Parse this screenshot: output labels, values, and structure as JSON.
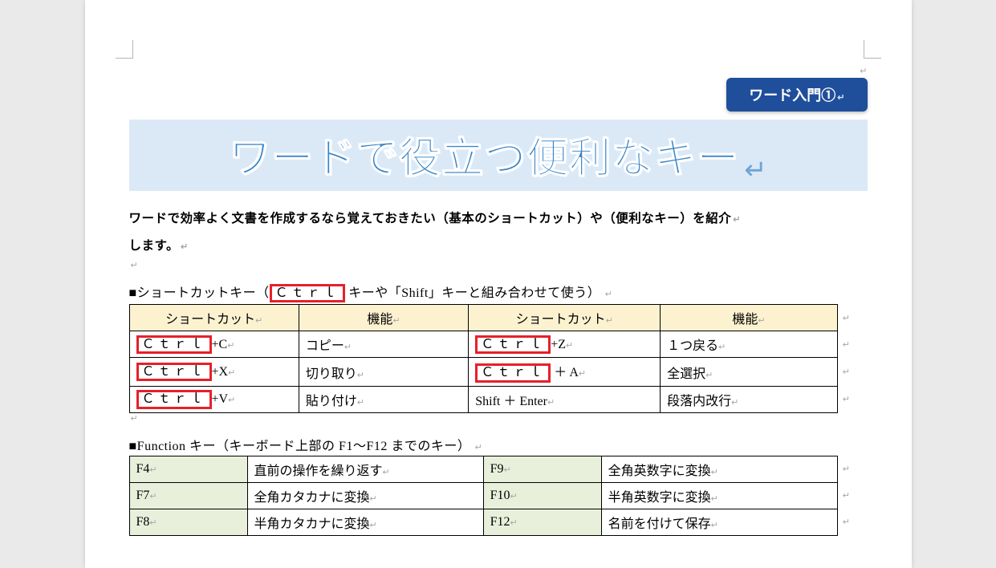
{
  "badge": "ワード入門①",
  "title": "ワードで役立つ便利なキー",
  "intro_line1": "ワードで効率よく文書を作成するなら覚えておきたい（基本のショートカット）や（便利なキー）を紹介",
  "intro_line2": "します。",
  "section1": {
    "prefix": "■ショートカットキー（",
    "highlight": "Ｃｔｒｌ",
    "suffix": " キーや「Shift」キーと組み合わせて使う）",
    "headers": [
      "ショートカット",
      "機能",
      "ショートカット",
      "機能"
    ],
    "rows": [
      {
        "a_hl": "Ｃｔｒｌ",
        "a_rest": "+C",
        "b": "コピー",
        "c_hl": "Ｃｔｒｌ",
        "c_rest": "+Z",
        "d": "１つ戻る"
      },
      {
        "a_hl": "Ｃｔｒｌ",
        "a_rest": "+X",
        "b": "切り取り",
        "c_hl": "Ｃｔｒｌ",
        "c_rest": " ＋ A",
        "d": "全選択"
      },
      {
        "a_hl": "Ｃｔｒｌ",
        "a_rest": "+V",
        "b": "貼り付け",
        "c_plain": "Shift ＋ Enter",
        "d": "段落内改行"
      }
    ]
  },
  "section2": {
    "heading": "■Function キー（キーボード上部の F1～F12 までのキー）",
    "rows": [
      {
        "a": "F4",
        "b": "直前の操作を繰り返す",
        "c": "F9",
        "d": "全角英数字に変換"
      },
      {
        "a": "F7",
        "b": "全角カタカナに変換",
        "c": "F10",
        "d": "半角英数字に変換"
      },
      {
        "a": "F8",
        "b": "半角カタカナに変換",
        "c": "F12",
        "d": "名前を付けて保存"
      }
    ]
  }
}
